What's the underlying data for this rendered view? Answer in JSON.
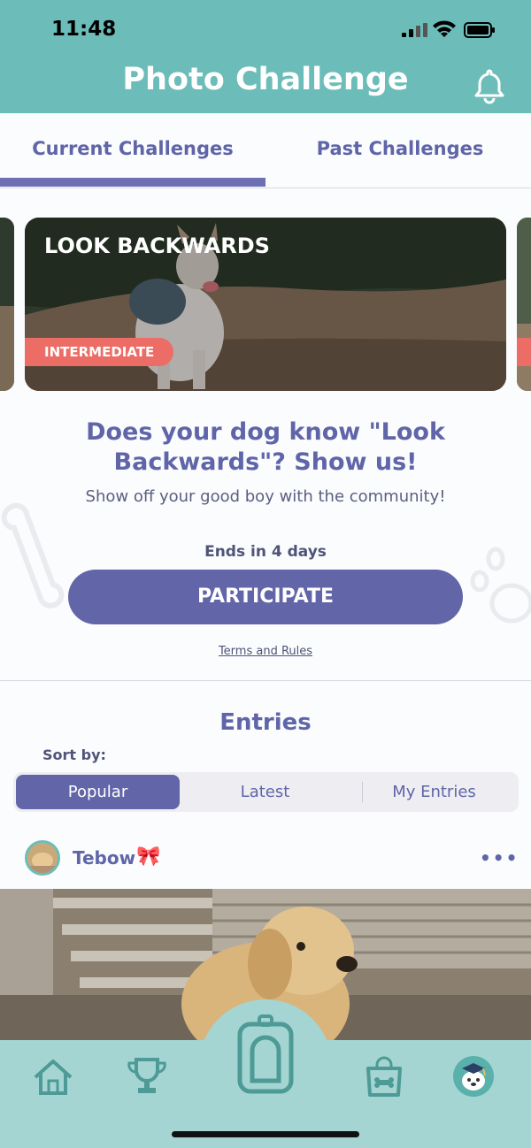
{
  "status_bar": {
    "time": "11:48"
  },
  "header": {
    "title": "Photo Challenge",
    "bell_icon": "bell-icon"
  },
  "tabs": [
    {
      "label": "Current Challenges",
      "active": true
    },
    {
      "label": "Past Challenges",
      "active": false
    }
  ],
  "challenge_card": {
    "title": "LOOK BACKWARDS",
    "level": "INTERMEDIATE"
  },
  "challenge": {
    "heading": "Does your dog know \"Look Backwards\"? Show us!",
    "subtitle": "Show off your good boy with the community!",
    "ends": "Ends in 4 days",
    "participate_label": "PARTICIPATE",
    "terms_label": "Terms and Rules"
  },
  "entries": {
    "title": "Entries",
    "sort_label": "Sort by:",
    "sort_options": [
      "Popular",
      "Latest",
      "My Entries"
    ],
    "selected_sort": "Popular"
  },
  "entry": {
    "name": "Tebow",
    "emoji": "🎀",
    "more_icon": "more-icon"
  },
  "bottom_nav": {
    "items": [
      "home-icon",
      "trophy-icon",
      "camera-tab-icon",
      "shop-icon",
      "profile-avatar-icon"
    ]
  },
  "colors": {
    "teal": "#6cbdb9",
    "purple": "#6266a8",
    "coral": "#ec6d66",
    "tabbar": "#a4d5d2"
  }
}
